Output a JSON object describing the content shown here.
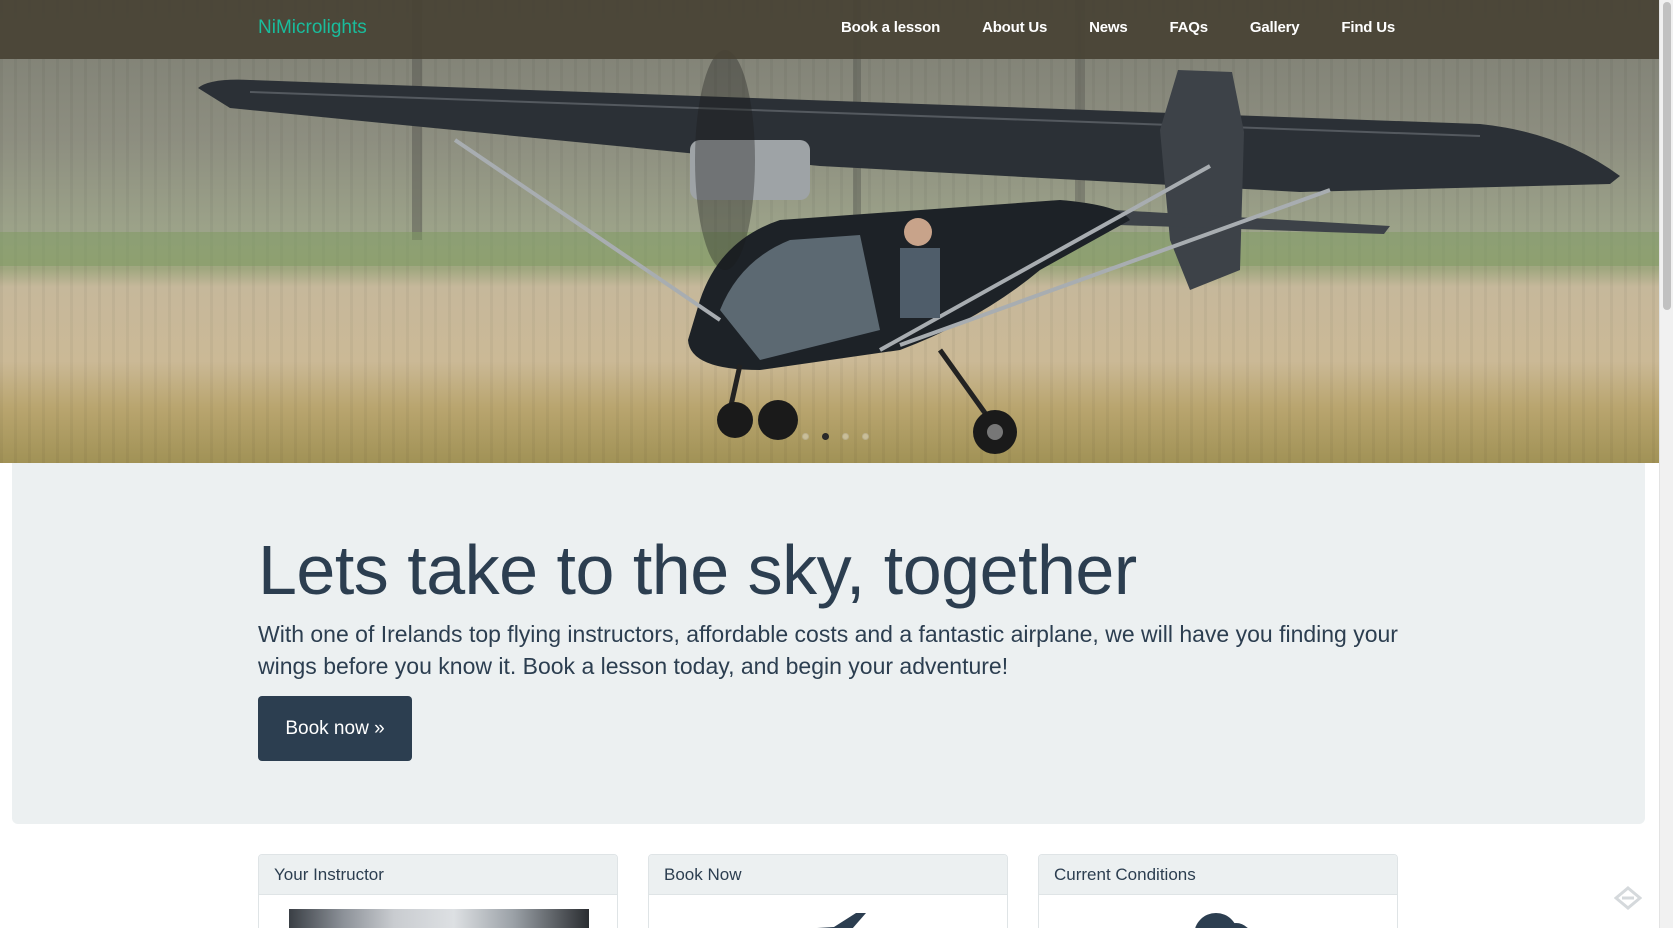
{
  "navbar": {
    "brand": "NiMicrolights",
    "links": [
      {
        "label": "Book a lesson"
      },
      {
        "label": "About Us"
      },
      {
        "label": "News"
      },
      {
        "label": "FAQs"
      },
      {
        "label": "Gallery"
      },
      {
        "label": "Find Us"
      }
    ]
  },
  "carousel": {
    "slide_count": 4,
    "active_index": 1,
    "image": "microlight-aircraft-photo"
  },
  "jumbotron": {
    "title": "Lets take to the sky, together",
    "text": "With one of Irelands top flying instructors, affordable costs and a fantastic airplane, we will have you finding your wings before you know it. Book a lesson today, and begin your adventure!",
    "button_label": "Book now »"
  },
  "panels": [
    {
      "heading": "Your Instructor",
      "content": "instructor-photo"
    },
    {
      "heading": "Book Now",
      "content": "plane-icon"
    },
    {
      "heading": "Current Conditions",
      "content": "cloud-icon"
    }
  ],
  "colors": {
    "brand": "#1abc9c",
    "primary": "#2c3e50",
    "jumbotron_bg": "#ecf0f1",
    "navbar_bg": "#484234"
  }
}
